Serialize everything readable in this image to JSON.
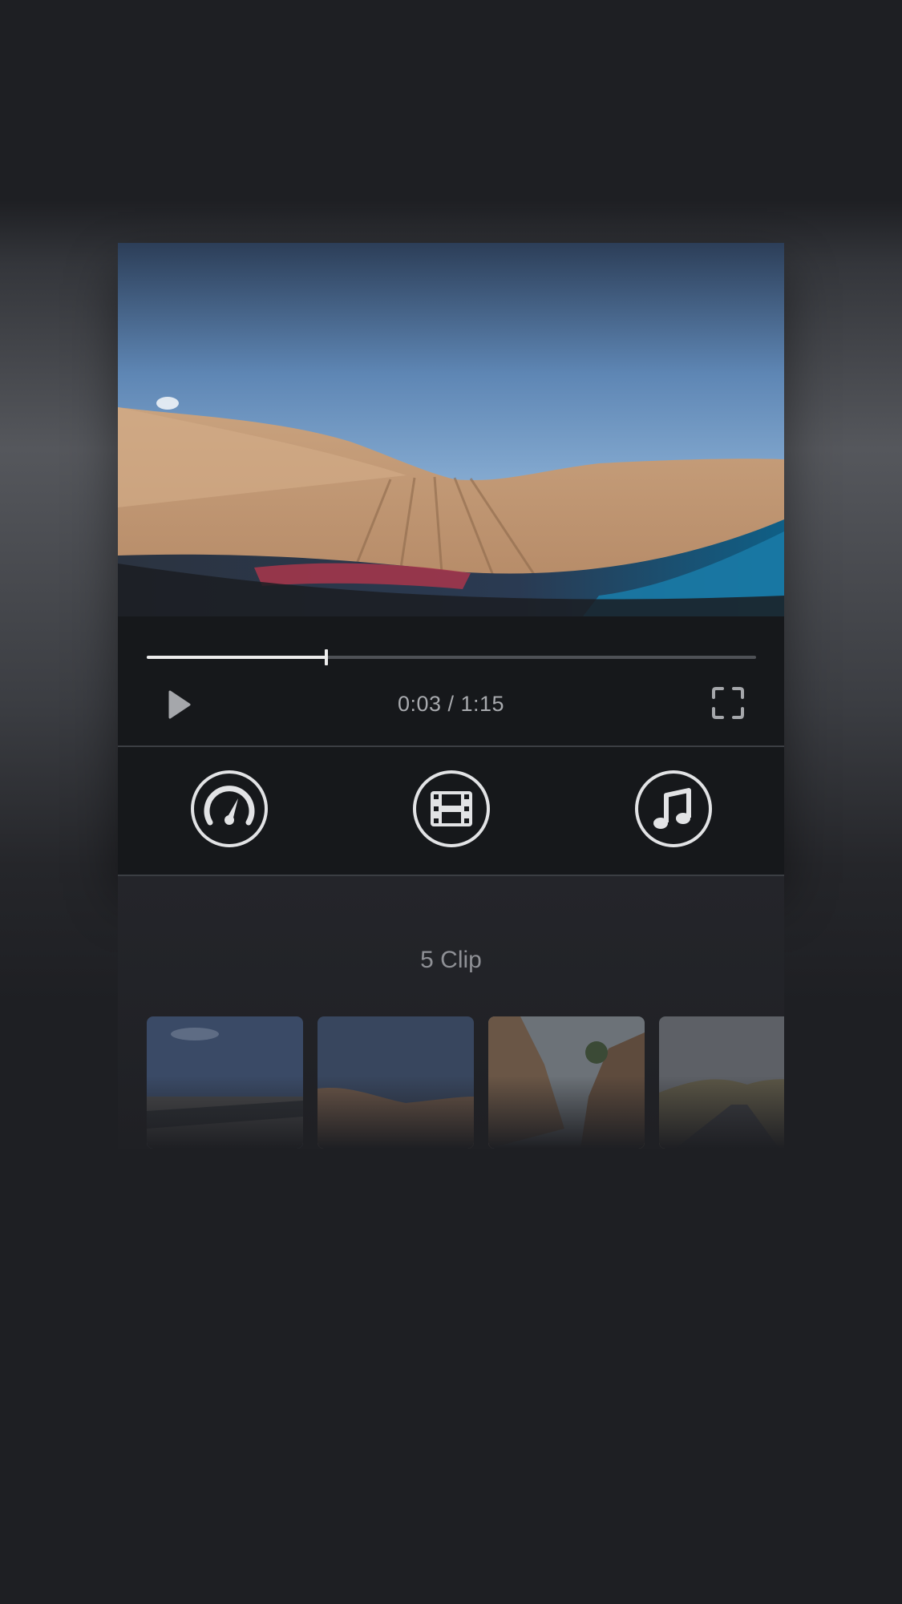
{
  "player": {
    "time_label": "0:03 / 1:15",
    "progress": 0.295,
    "play_icon": "play-icon",
    "fullscreen_icon": "fullscreen-icon"
  },
  "tools": [
    {
      "icon": "speedometer-icon"
    },
    {
      "icon": "film-icon"
    },
    {
      "icon": "music-note-icon"
    }
  ],
  "clips": {
    "title": "5 Clip",
    "count": 5
  },
  "colors": {
    "background": "#1e1f23",
    "panel": "#16181b",
    "accent": "#ececec"
  }
}
